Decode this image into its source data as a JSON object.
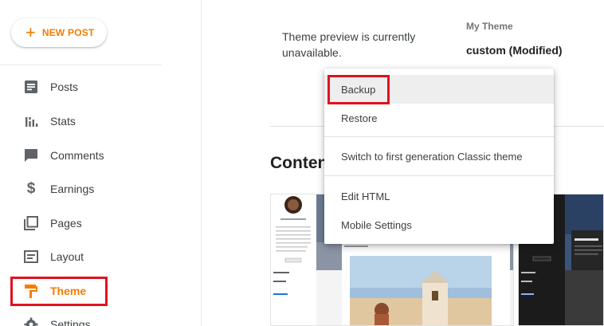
{
  "sidebar": {
    "new_post_label": "NEW POST",
    "items": [
      {
        "label": "Posts",
        "icon": "posts-icon"
      },
      {
        "label": "Stats",
        "icon": "stats-icon"
      },
      {
        "label": "Comments",
        "icon": "comments-icon"
      },
      {
        "label": "Earnings",
        "icon": "dollar-icon"
      },
      {
        "label": "Pages",
        "icon": "pages-icon"
      },
      {
        "label": "Layout",
        "icon": "layout-icon"
      },
      {
        "label": "Theme",
        "icon": "theme-roller-icon",
        "active": true
      },
      {
        "label": "Settings",
        "icon": "gear-icon"
      }
    ]
  },
  "main": {
    "preview_text": "Theme preview is currently unavailable.",
    "my_theme_label": "My Theme",
    "my_theme_name": "custom (Modified)",
    "content_heading": "Conten"
  },
  "menu": {
    "items": [
      "Backup",
      "Restore",
      "Switch to first generation Classic theme",
      "Edit HTML",
      "Mobile Settings"
    ]
  },
  "colors": {
    "accent": "#f57c00",
    "highlight": "#e0121f",
    "icon": "#5f6368"
  }
}
